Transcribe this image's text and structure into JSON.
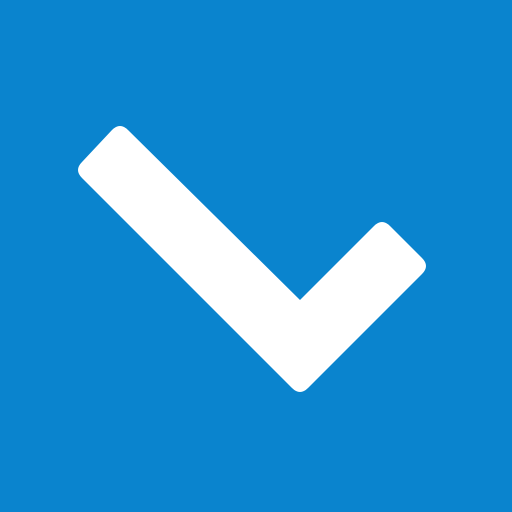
{
  "icon": {
    "name": "checkmark-icon",
    "background_color": "#0a84ce",
    "mark_color": "#ffffff"
  }
}
